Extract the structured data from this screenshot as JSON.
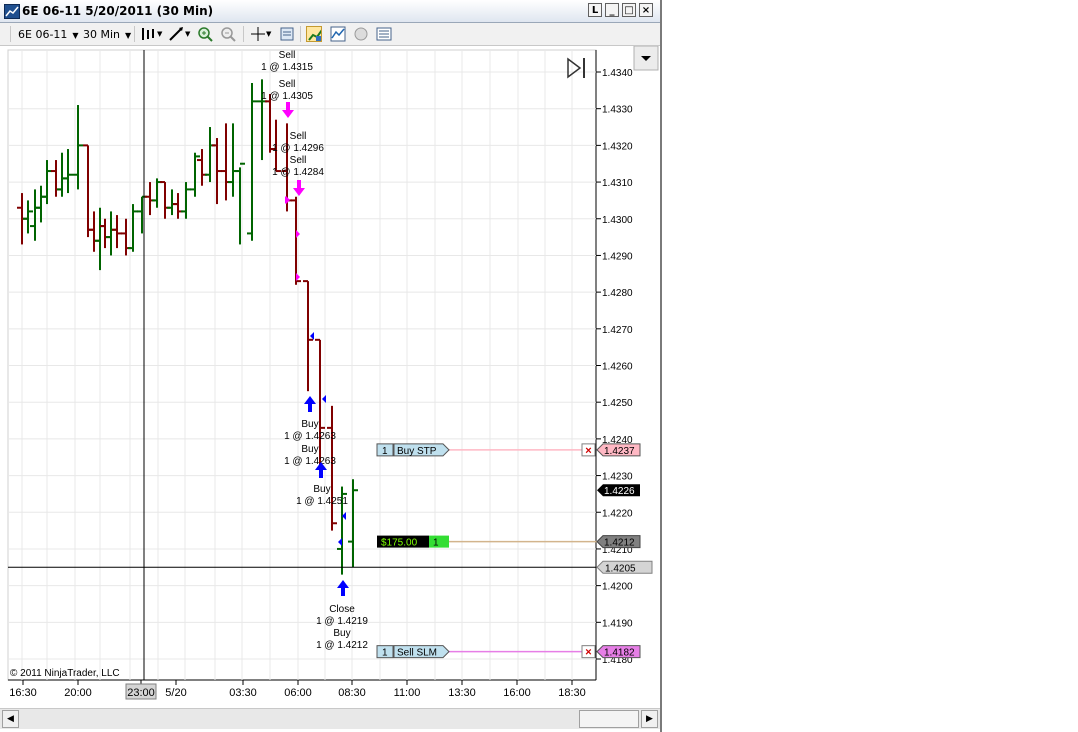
{
  "window": {
    "title": "6E 06-11  5/20/2011 (30 Min)",
    "buttons": [
      "L",
      "□",
      "×"
    ]
  },
  "toolbar": {
    "instrument": "6E 06-11",
    "interval": "30 Min",
    "icons": [
      "bars-style-icon",
      "drawing-tool-icon",
      "zoom-in-icon",
      "zoom-out-icon",
      "crosshair-icon",
      "data-box-icon",
      "chart-trader-icon",
      "indicators-icon",
      "strategies-icon",
      "properties-icon"
    ]
  },
  "chart": {
    "copyright": "© 2011 NinjaTrader, LLC",
    "price_labels": [
      "1.4340",
      "1.4330",
      "1.4320",
      "1.4310",
      "1.4300",
      "1.4290",
      "1.4280",
      "1.4270",
      "1.4260",
      "1.4250",
      "1.4240",
      "1.4230",
      "1.4220",
      "1.4210",
      "1.4200",
      "1.4190",
      "1.4180"
    ],
    "time_labels": [
      "16:30",
      "20:00",
      "23:00",
      "5/20",
      "03:30",
      "06:00",
      "08:30",
      "11:00",
      "13:30",
      "16:00",
      "18:30"
    ],
    "crosshair_time": "23:00",
    "crosshair_price": "1.4205",
    "last_price": "1.4226",
    "orders": [
      {
        "qty": "1",
        "type": "Buy STP",
        "price": "1.4237",
        "color": "#ffb8c4"
      },
      {
        "qty": "1",
        "type": "Sell SLM",
        "price": "1.4182",
        "color": "#e67ee6"
      }
    ],
    "position": {
      "pnl": "$175.00",
      "qty": "1",
      "price": "1.4212"
    },
    "executions": [
      {
        "side": "Sell",
        "text": "1 @ 1.4315"
      },
      {
        "side": "Sell",
        "text": "1 @ 1.4305"
      },
      {
        "side": "Sell",
        "text": "1 @ 1.4296"
      },
      {
        "side": "Sell",
        "text": "1 @ 1.4284"
      },
      {
        "side": "Buy",
        "text": "1 @ 1.4263"
      },
      {
        "side": "Buy",
        "text": "1 @ 1.4263"
      },
      {
        "side": "Buy",
        "text": "1 @ 1.4251"
      },
      {
        "side": "Close",
        "text": "1 @ 1.4219"
      },
      {
        "side": "Buy",
        "text": "1 @ 1.4212"
      }
    ],
    "colors": {
      "up": "#006400",
      "down": "#800000",
      "sell_arrow": "#ff00ff",
      "buy_arrow": "#0000ff"
    }
  }
}
